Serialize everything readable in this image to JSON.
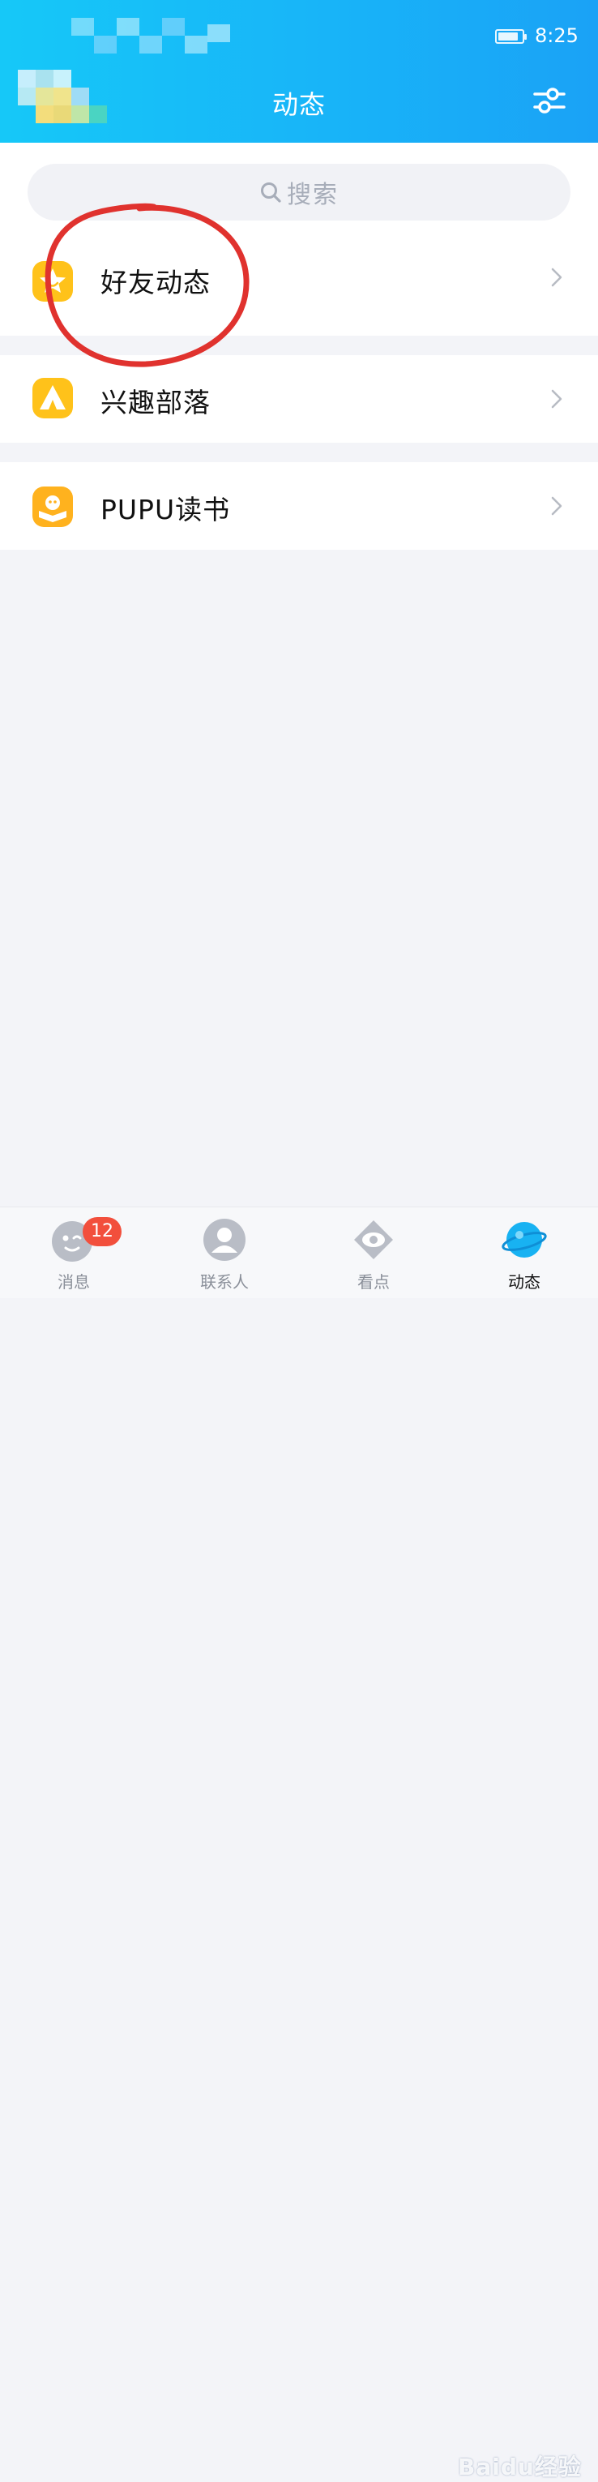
{
  "status_bar": {
    "time": "8:25"
  },
  "header": {
    "title": "动态",
    "settings_icon": "sliders-icon"
  },
  "search": {
    "placeholder": "搜索",
    "icon": "search-icon"
  },
  "list": {
    "items": [
      {
        "label": "好友动态",
        "icon": "star-icon",
        "color": "#ffc21a"
      },
      {
        "label": "兴趣部落",
        "icon": "tent-icon",
        "color": "#ffc21a"
      },
      {
        "label": "PUPU读书",
        "icon": "book-icon",
        "color": "#ffb21e"
      }
    ]
  },
  "tab_bar": {
    "tabs": [
      {
        "label": "消息",
        "icon": "message-icon",
        "badge": "12"
      },
      {
        "label": "联系人",
        "icon": "contacts-icon"
      },
      {
        "label": "看点",
        "icon": "eye-icon"
      },
      {
        "label": "动态",
        "icon": "planet-icon",
        "active": true
      }
    ]
  },
  "watermark": "Baidu经验",
  "colors": {
    "header_start": "#16c8f8",
    "header_end": "#1aa2f6",
    "background": "#f3f4f8",
    "badge": "#f24f3c",
    "annotation": "#e0322e",
    "icon_yellow": "#ffc21a"
  }
}
